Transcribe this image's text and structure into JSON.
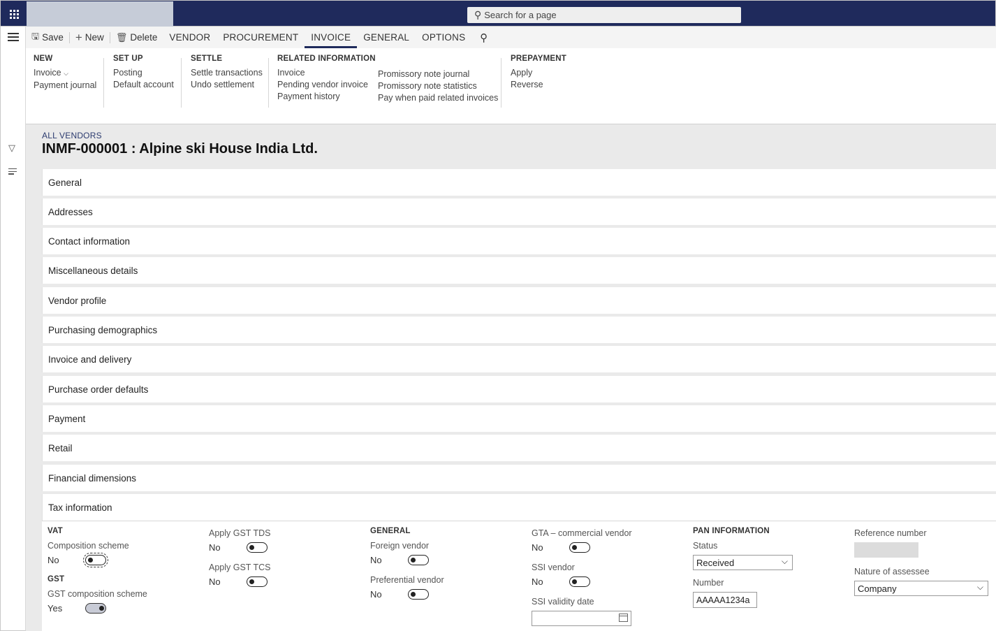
{
  "topbar": {
    "search_placeholder": "Search for a page",
    "icons": [
      "waffle-icon",
      "search-icon"
    ]
  },
  "actionbar": {
    "save": "Save",
    "new": "New",
    "delete": "Delete",
    "tabs": [
      "VENDOR",
      "PROCUREMENT",
      "INVOICE",
      "GENERAL",
      "OPTIONS"
    ],
    "active_tab": "INVOICE"
  },
  "ribbon": {
    "new": {
      "header": "NEW",
      "items": [
        "Invoice",
        "Payment journal"
      ]
    },
    "setup": {
      "header": "SET UP",
      "items": [
        "Posting",
        "Default account"
      ]
    },
    "settle": {
      "header": "SETTLE",
      "items": [
        "Settle transactions",
        "Undo settlement"
      ]
    },
    "related": {
      "header": "RELATED INFORMATION",
      "col1": [
        "Invoice",
        "Pending vendor invoice",
        "Payment history"
      ],
      "col2": [
        "Promissory note journal",
        "Promissory note statistics",
        "Pay when paid related invoices"
      ]
    },
    "prepayment": {
      "header": "PREPAYMENT",
      "items": [
        "Apply",
        "Reverse"
      ]
    }
  },
  "page": {
    "breadcrumb": "ALL VENDORS",
    "title": "INMF-000001 : Alpine ski House India Ltd."
  },
  "sections": [
    "General",
    "Addresses",
    "Contact information",
    "Miscellaneous details",
    "Vendor profile",
    "Purchasing demographics",
    "Invoice and delivery",
    "Purchase order defaults",
    "Payment",
    "Retail",
    "Financial dimensions",
    "Tax information"
  ],
  "tax": {
    "vat_header": "VAT",
    "composition_scheme": {
      "label": "Composition scheme",
      "value": "No"
    },
    "gst_header": "GST",
    "gst_composition_scheme": {
      "label": "GST composition scheme",
      "value": "Yes"
    },
    "apply_gst_tds": {
      "label": "Apply GST TDS",
      "value": "No"
    },
    "apply_gst_tcs": {
      "label": "Apply GST TCS",
      "value": "No"
    },
    "general_header": "GENERAL",
    "foreign_vendor": {
      "label": "Foreign vendor",
      "value": "No"
    },
    "preferential_vendor": {
      "label": "Preferential vendor",
      "value": "No"
    },
    "gta_commercial_vendor": {
      "label": "GTA – commercial vendor",
      "value": "No"
    },
    "ssi_vendor": {
      "label": "SSI vendor",
      "value": "No"
    },
    "ssi_validity_date": {
      "label": "SSI validity date",
      "value": ""
    },
    "pan_header": "PAN INFORMATION",
    "status": {
      "label": "Status",
      "value": "Received"
    },
    "number": {
      "label": "Number",
      "value": "AAAAA1234a"
    },
    "reference_number": {
      "label": "Reference number",
      "value": ""
    },
    "nature_of_assessee": {
      "label": "Nature of assessee",
      "value": "Company"
    }
  }
}
